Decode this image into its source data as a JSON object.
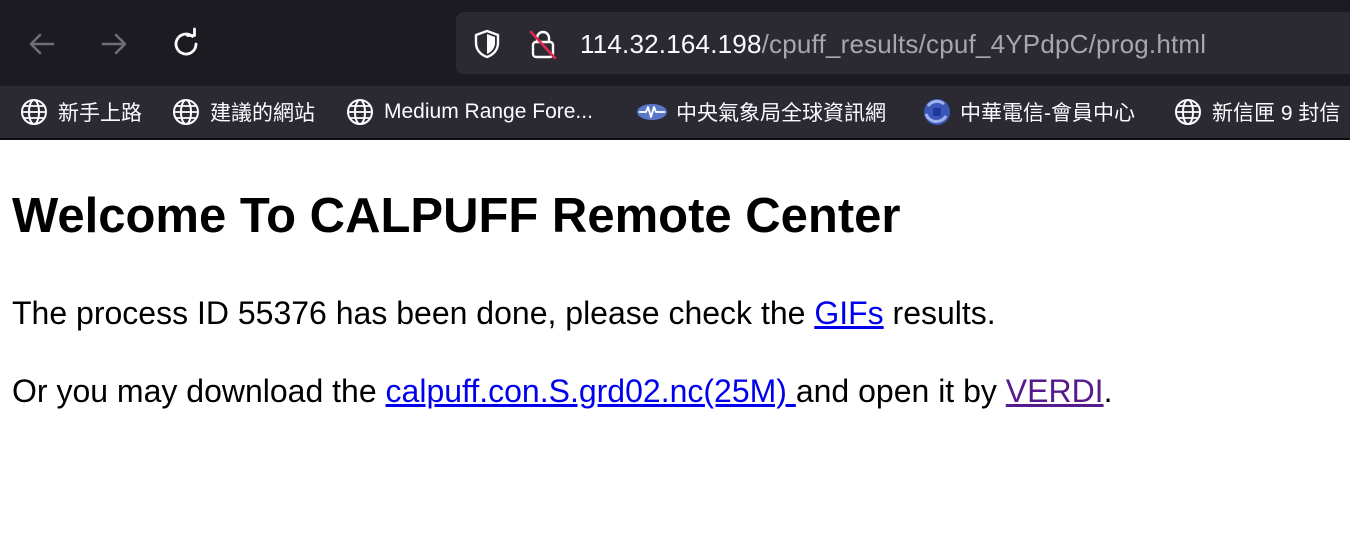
{
  "browser": {
    "url_host": "114.32.164.198",
    "url_path": "/cpuff_results/cpuf_4YPdpC/prog.html",
    "nav": {
      "back_icon": "arrow-left-icon",
      "forward_icon": "arrow-right-icon",
      "reload_icon": "reload-icon"
    },
    "bookmarks": [
      {
        "label": "新手上路",
        "icon": "globe-icon"
      },
      {
        "label": "建議的網站",
        "icon": "globe-icon"
      },
      {
        "label": "Medium Range Fore...",
        "icon": "globe-icon"
      },
      {
        "label": "中央氣象局全球資訊網",
        "icon": "cwb-logo-icon"
      },
      {
        "label": "中華電信-會員中心",
        "icon": "cht-logo-icon"
      },
      {
        "label": "新信匣 9 封信",
        "icon": "globe-icon"
      }
    ]
  },
  "page": {
    "title": "Welcome To CALPUFF Remote Center",
    "p1_before": "The process ID 55376 has been done, please check the ",
    "p1_link": "GIFs",
    "p1_after": " results.",
    "p2_before": "Or you may download the ",
    "p2_link": "calpuff.con.S.grd02.nc(25M) ",
    "p2_middle": "and open it by ",
    "p2_link2": "VERDI",
    "p2_after": "."
  },
  "colors": {
    "toolbar_bg": "#1c1b22",
    "bookmarks_bg": "#2b2a33",
    "link": "#0000ee",
    "visited_link": "#551a8b"
  }
}
